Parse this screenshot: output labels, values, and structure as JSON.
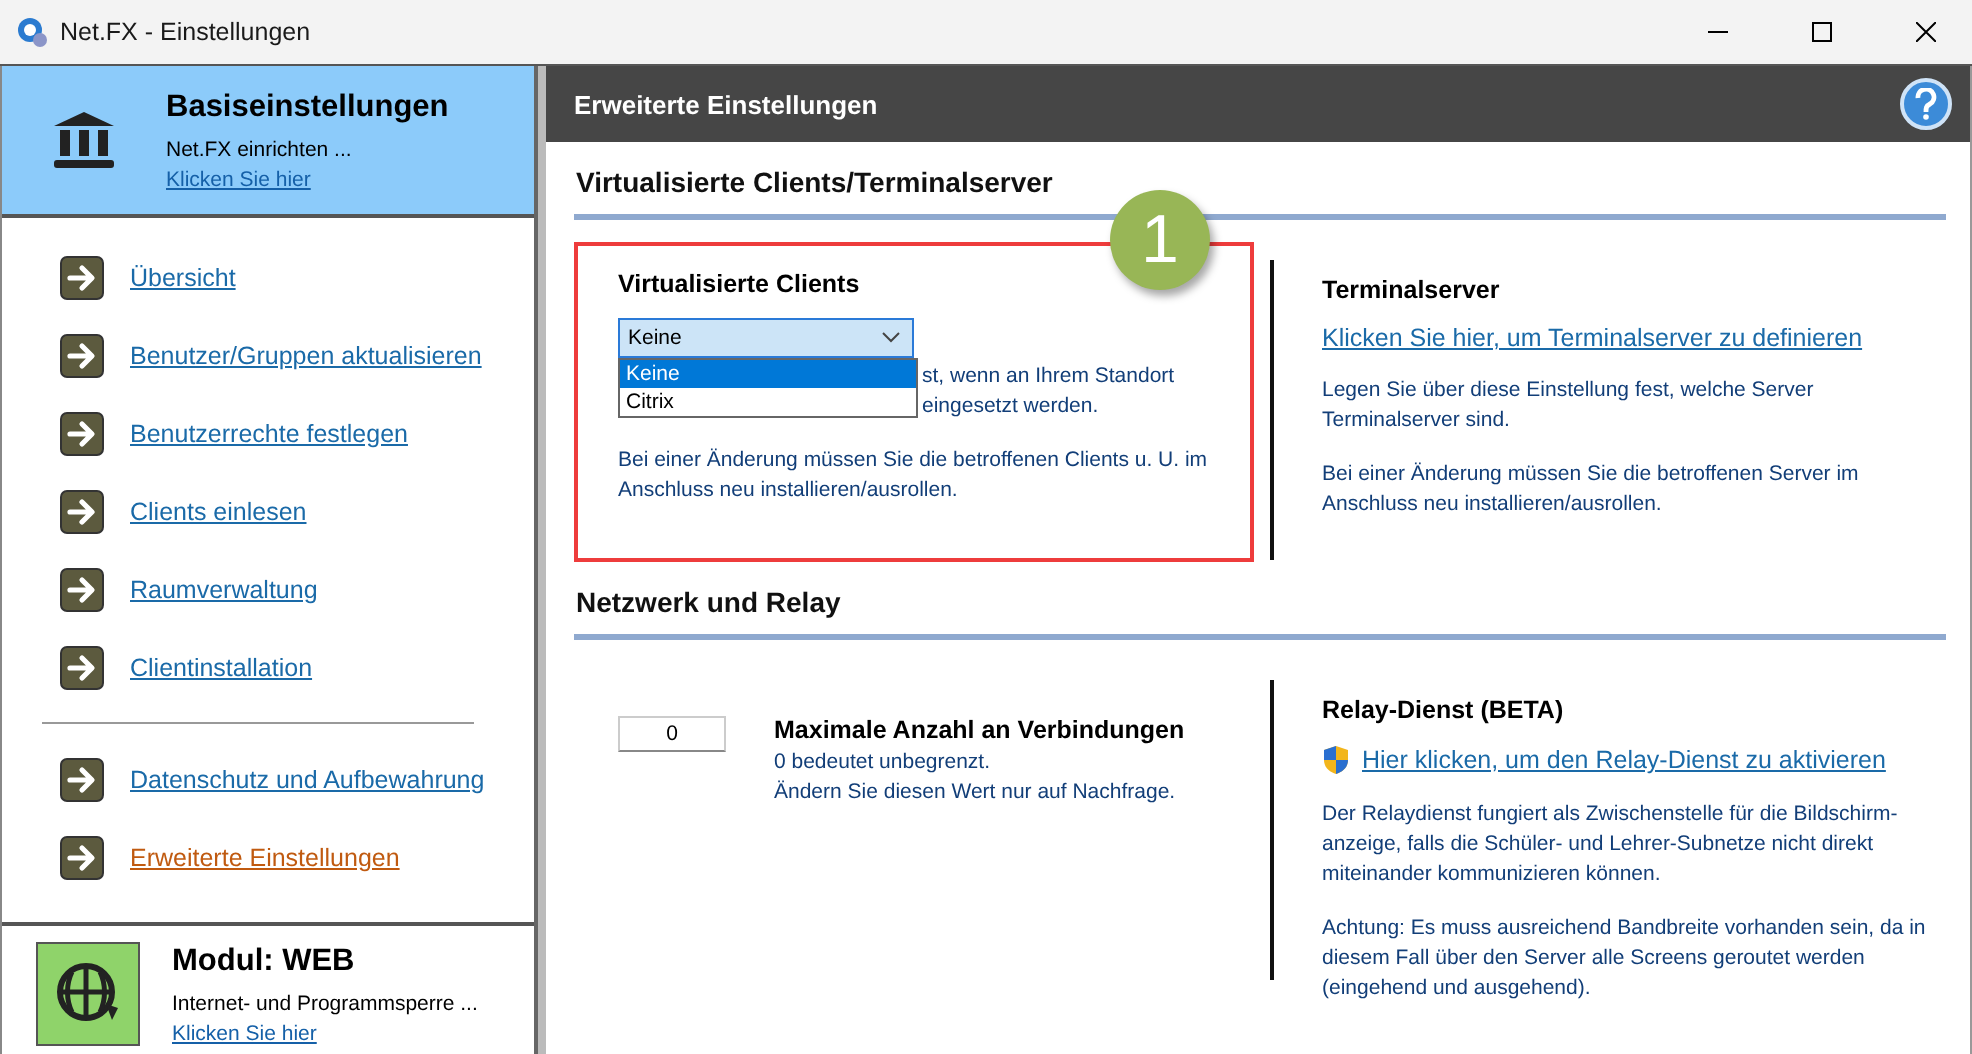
{
  "window": {
    "title": "Net.FX - Einstellungen"
  },
  "sidebar": {
    "header": {
      "title": "Basiseinstellungen",
      "subtitle": "Net.FX einrichten ...",
      "link": "Klicken Sie hier"
    },
    "groups": [
      [
        {
          "label": "Übersicht",
          "selected": false
        },
        {
          "label": "Benutzer/Gruppen aktualisieren",
          "selected": false
        },
        {
          "label": "Benutzerrechte festlegen",
          "selected": false
        },
        {
          "label": "Clients einlesen",
          "selected": false
        },
        {
          "label": "Raumverwaltung",
          "selected": false
        },
        {
          "label": "Clientinstallation",
          "selected": false
        }
      ],
      [
        {
          "label": "Datenschutz und Aufbewahrung",
          "selected": false
        },
        {
          "label": "Erweiterte Einstellungen",
          "selected": true
        }
      ]
    ],
    "module": {
      "title": "Modul: WEB",
      "subtitle": "Internet- und Programmsperre ...",
      "link": "Klicken Sie hier"
    }
  },
  "main": {
    "title": "Erweiterte Einstellungen",
    "sections": [
      {
        "title": "Virtualisierte Clients/Terminalserver",
        "left": {
          "kind": "select",
          "badge": "1",
          "title": "Virtualisierte Clients",
          "value": "Keine",
          "options": [
            {
              "label": "Keine",
              "selected": true
            },
            {
              "label": "Citrix",
              "selected": false
            }
          ],
          "covered_lines": [
            "st, wenn an Ihrem Standort",
            "eingesetzt werden."
          ],
          "note": "Bei einer Änderung müssen Sie die betroffenen Clients u. U. im Anschluss neu installieren/ausrollen."
        },
        "right": {
          "title": "Terminalserver",
          "link": "Klicken Sie hier, um Terminalserver zu definieren",
          "shield": false,
          "paragraphs": [
            "Legen Sie über diese Einstellung fest, welche Server Terminalserver sind.",
            "Bei einer Änderung müssen Sie die betroffenen Server im Anschluss neu installieren/ausrollen."
          ]
        }
      },
      {
        "title": "Netzwerk und Relay",
        "left": {
          "kind": "number",
          "value": "0",
          "title": "Maximale Anzahl an Verbindungen",
          "lines": [
            "0 bedeutet unbegrenzt.",
            "Ändern Sie diesen Wert nur auf Nachfrage."
          ]
        },
        "right": {
          "title": "Relay-Dienst (BETA)",
          "link": "Hier klicken, um den Relay-Dienst zu aktivieren",
          "shield": true,
          "paragraphs": [
            "Der Relaydienst fungiert als Zwischenstelle für die Bildschirm-anzeige, falls die Schüler- und Lehrer-Subnetze nicht direkt miteinander kommunizieren können.",
            "Achtung: Es muss ausreichend Bandbreite vorhanden sein, da in diesem Fall über den Server alle Screens geroutet werden (eingehend und ausgehend)."
          ]
        }
      }
    ]
  }
}
